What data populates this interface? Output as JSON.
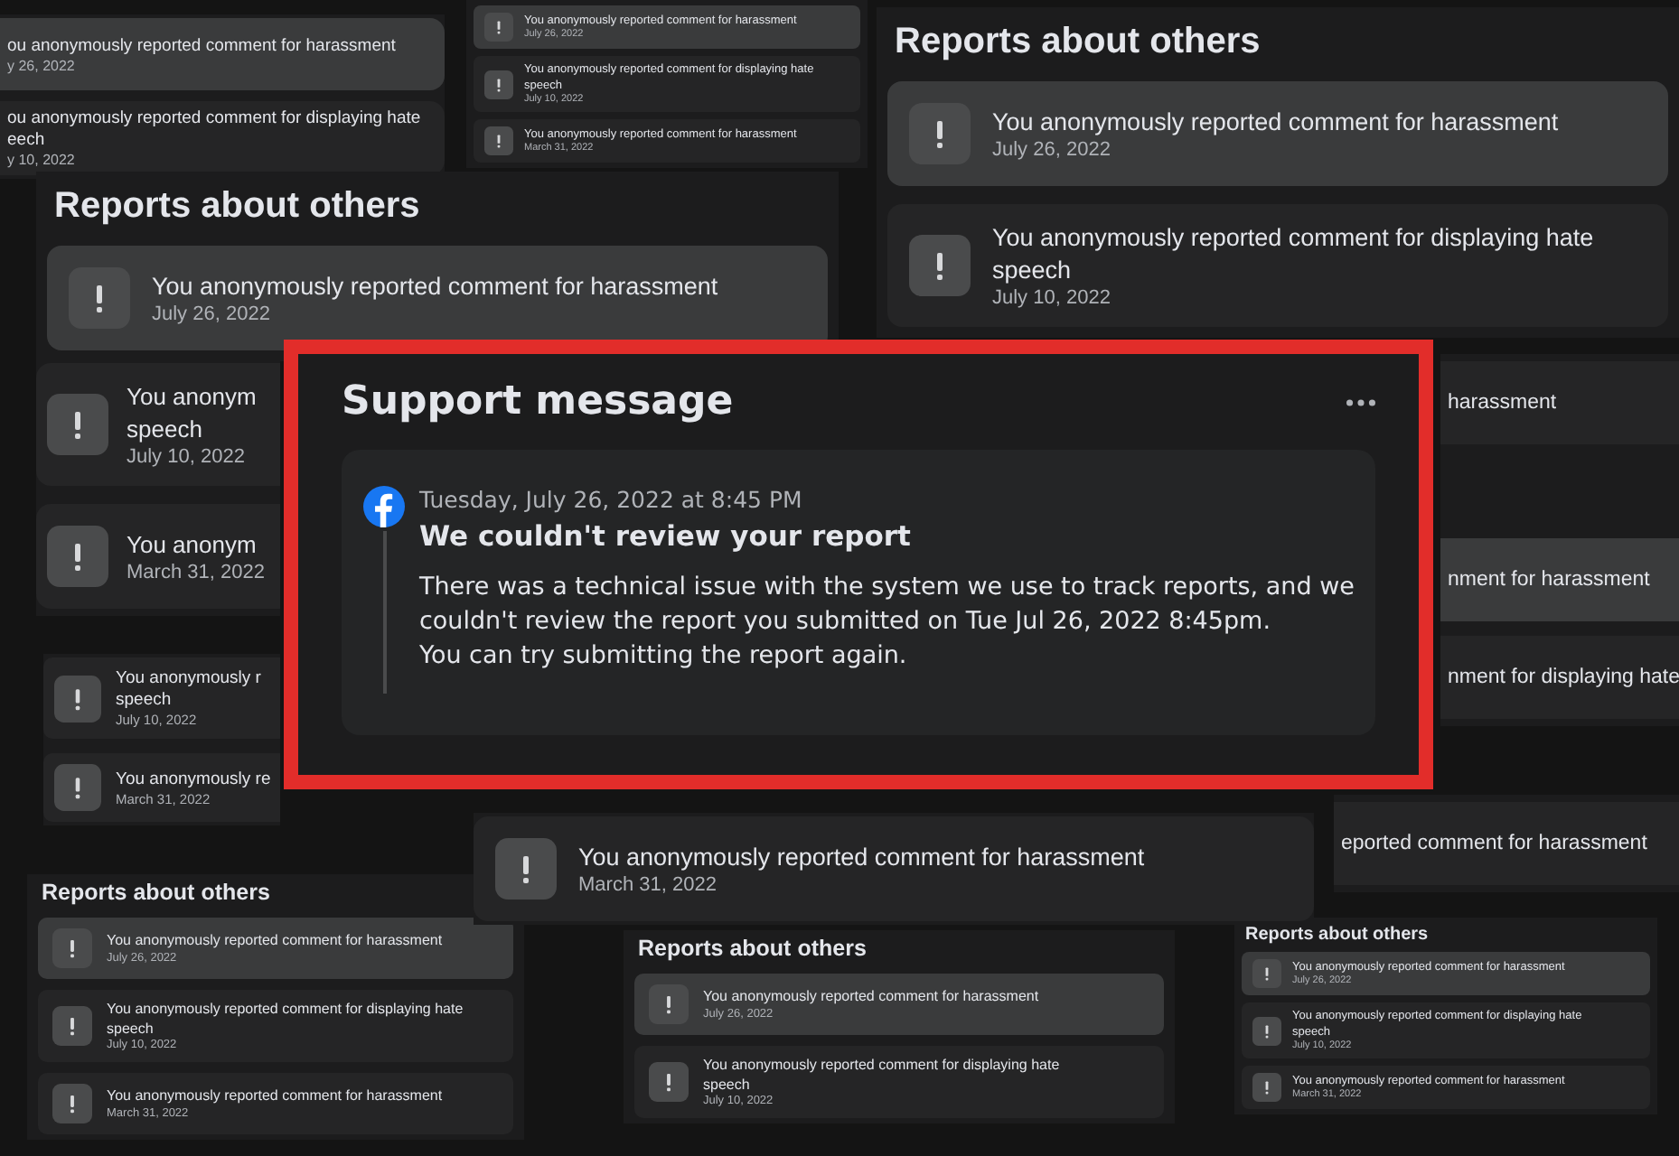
{
  "panels": [
    {
      "items": [
        {
          "text": "ou anonymously reported comment for harassment",
          "date": "y 26, 2022",
          "selected": true
        },
        {
          "text": "ou anonymously reported comment for displaying hate\neech",
          "date": "y 10, 2022",
          "selected": false
        }
      ]
    },
    {
      "items": [
        {
          "text": "You anonymously reported comment for harassment",
          "date": "July 26, 2022",
          "selected": true
        },
        {
          "text": "You anonymously reported comment for displaying hate\nspeech",
          "date": "July 10, 2022",
          "selected": false
        },
        {
          "text": "You anonymously reported comment for harassment",
          "date": "March 31, 2022",
          "selected": false
        }
      ]
    },
    {
      "title": "Reports about others",
      "items": [
        {
          "text": "You anonymously reported comment for harassment",
          "date": "July 26, 2022",
          "selected": true
        },
        {
          "text": "You anonymously reported comment for displaying hate\nspeech",
          "date": "July 10, 2022",
          "selected": false
        }
      ]
    },
    {
      "title": "Reports about others",
      "items": [
        {
          "text": "You anonymously reported comment for harassment",
          "date": "July 26, 2022",
          "selected": true
        }
      ]
    },
    {
      "items": [
        {
          "text": "You anonym\nspeech",
          "date": "July 10, 2022",
          "selected": false
        },
        {
          "text": "You anonym",
          "date": "March 31, 2022",
          "selected": false
        }
      ]
    },
    {
      "items": [
        {
          "text": "harassment",
          "selected": false
        },
        {
          "text": "nment for harassment",
          "selected": true
        },
        {
          "text": "nment for displaying hate",
          "selected": false
        }
      ]
    },
    {
      "items": [
        {
          "text": "eported comment for harassment",
          "selected": false
        }
      ]
    },
    {
      "items": [
        {
          "text": "You anonymously r\nspeech",
          "date": "July 10, 2022",
          "selected": false
        },
        {
          "text": "You anonymously re",
          "date": "March 31, 2022",
          "selected": false
        }
      ]
    },
    {
      "title": "Reports about others",
      "items": [
        {
          "text": "You anonymously reported comment for harassment",
          "date": "July 26, 2022",
          "selected": true
        },
        {
          "text": "You anonymously reported comment for displaying hate\nspeech",
          "date": "July 10, 2022",
          "selected": false
        },
        {
          "text": "You anonymously reported comment for harassment",
          "date": "March 31, 2022",
          "selected": false
        }
      ]
    },
    {
      "title": "Reports about others",
      "items": [
        {
          "text": "You anonymously reported comment for harassment",
          "date": "July 26, 2022",
          "selected": true
        },
        {
          "text": "You anonymously reported comment for displaying hate\nspeech",
          "date": "July 10, 2022",
          "selected": false
        }
      ]
    },
    {
      "title": "Reports about others",
      "items": [
        {
          "text": "You anonymously reported comment for harassment",
          "date": "July 26, 2022",
          "selected": true
        },
        {
          "text": "You anonymously reported comment for displaying hate\nspeech",
          "date": "July 10, 2022",
          "selected": false
        },
        {
          "text": "You anonymously reported comment for harassment",
          "date": "March 31, 2022",
          "selected": false
        }
      ]
    },
    {
      "items": [
        {
          "text": "You anonymously reported comment for harassment",
          "date": "March 31, 2022",
          "selected": false
        }
      ]
    }
  ],
  "support_message": {
    "title": "Support message",
    "timestamp": "Tuesday, July 26, 2022 at 8:45 PM",
    "heading": "We couldn't review your report",
    "body": "There was a technical issue with the system we use to track reports, and we couldn't review the report you submitted on Tue Jul 26, 2022 8:45pm.\nYou can try submitting the report again."
  }
}
